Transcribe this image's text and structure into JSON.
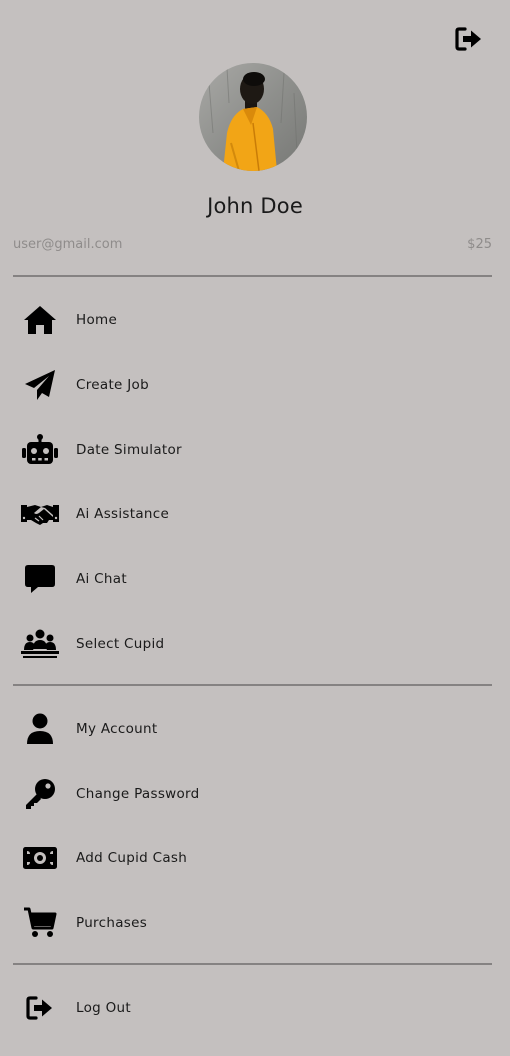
{
  "header": {
    "logout_icon": "sign-out-icon",
    "avatar_alt": "profile photo"
  },
  "user": {
    "name": "John Doe",
    "email": "user@gmail.com",
    "balance": "$25"
  },
  "menu": {
    "primary": [
      {
        "label": "Home",
        "icon": "home-icon"
      },
      {
        "label": "Create Job",
        "icon": "paper-plane-icon"
      },
      {
        "label": "Date Simulator",
        "icon": "robot-icon"
      },
      {
        "label": "Ai Assistance",
        "icon": "handshake-icon"
      },
      {
        "label": "Ai Chat",
        "icon": "chat-bubble-icon"
      },
      {
        "label": "Select Cupid",
        "icon": "people-group-icon"
      }
    ],
    "account": [
      {
        "label": "My Account",
        "icon": "user-icon"
      },
      {
        "label": "Change Password",
        "icon": "key-icon"
      },
      {
        "label": "Add Cupid Cash",
        "icon": "money-bill-icon"
      },
      {
        "label": "Purchases",
        "icon": "shopping-cart-icon"
      }
    ],
    "footer": [
      {
        "label": "Log Out",
        "icon": "sign-out-icon"
      }
    ]
  },
  "colors": {
    "background": "#c4c0bf",
    "divider": "#858282",
    "muted_text": "#8f8c8b",
    "avatar_jacket": "#f2a516"
  }
}
